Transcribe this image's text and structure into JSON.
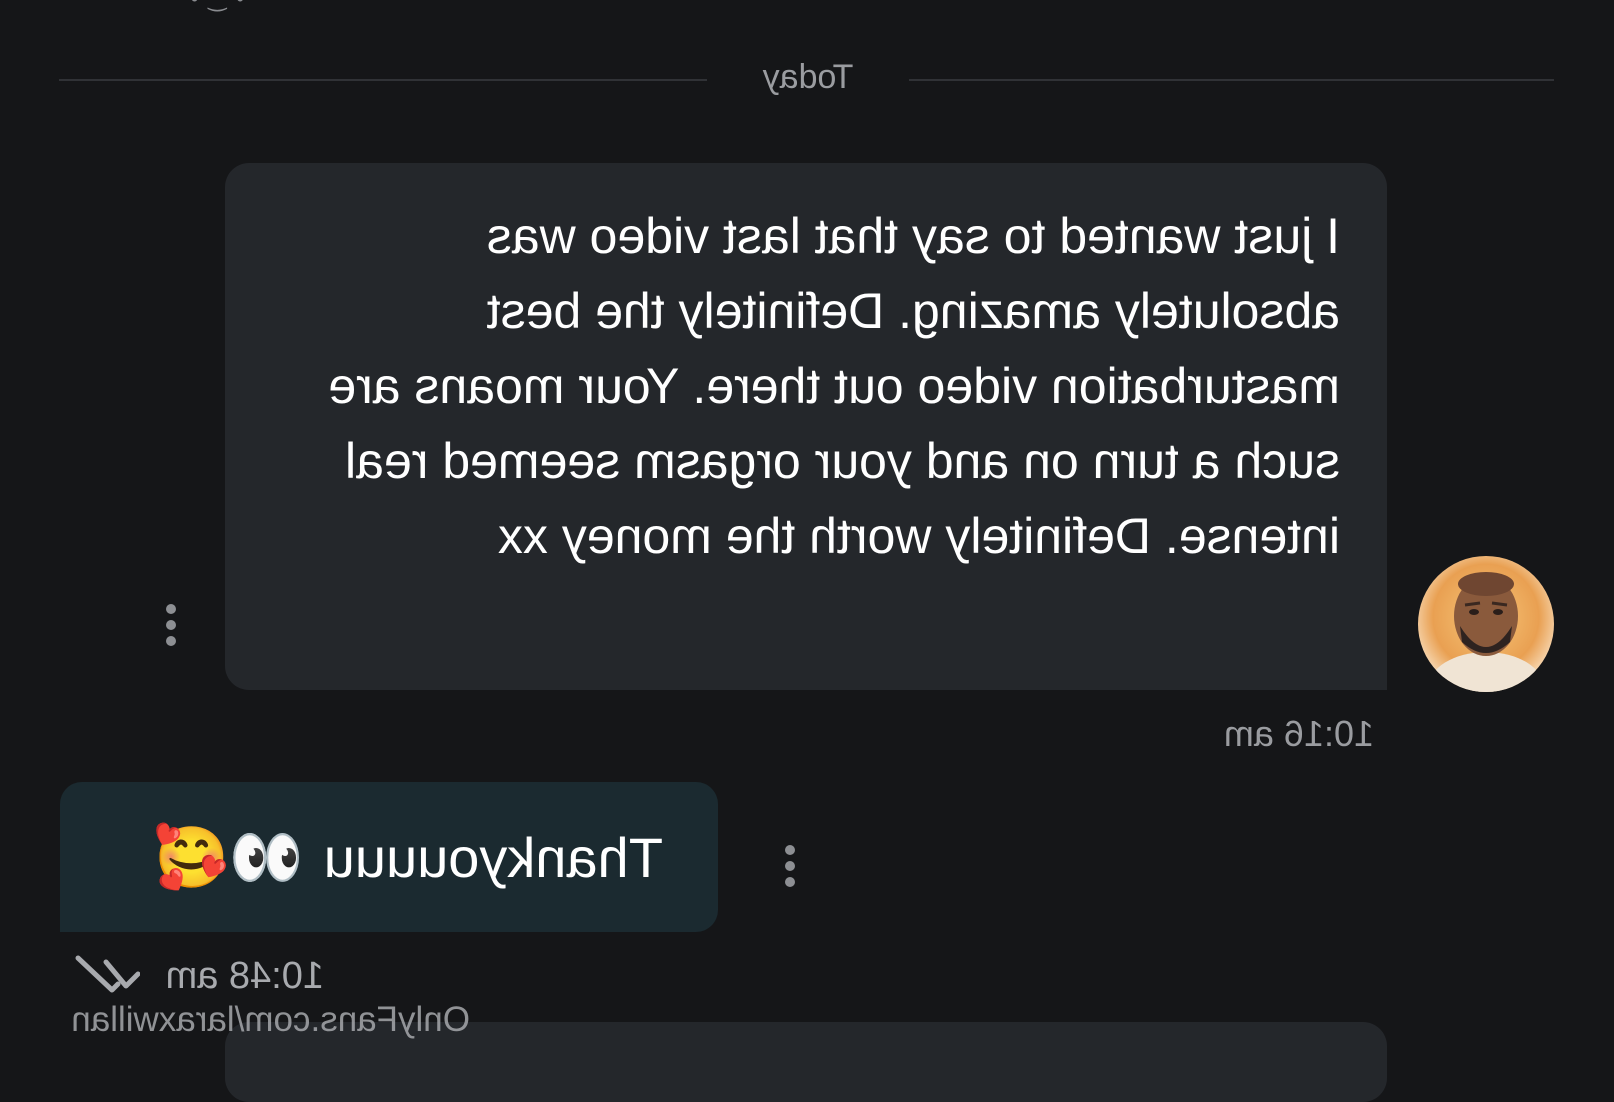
{
  "header": {
    "top_fragment": "• ‿ •"
  },
  "date_divider": {
    "label": "Today"
  },
  "messages": [
    {
      "direction": "incoming",
      "text": "I just wanted to say that last video was absolutely amazing. Definitely the best masturbation video out there. Your moans are such a turn on and your orgasm seemed real intense. Definitely worth the money xx",
      "time": "10:16 am"
    },
    {
      "direction": "outgoing",
      "text": "Thankyouuuu",
      "emoji": "👀🥰",
      "time": "10:48 am",
      "status_icon": "double-check-icon"
    }
  ],
  "watermark": {
    "text": "OnlyFans.com/laraxwillan"
  },
  "colors": {
    "background": "#151618",
    "incoming_bubble": "#24272b",
    "outgoing_bubble": "#1b2a30",
    "muted_text": "#9a9ca0"
  }
}
